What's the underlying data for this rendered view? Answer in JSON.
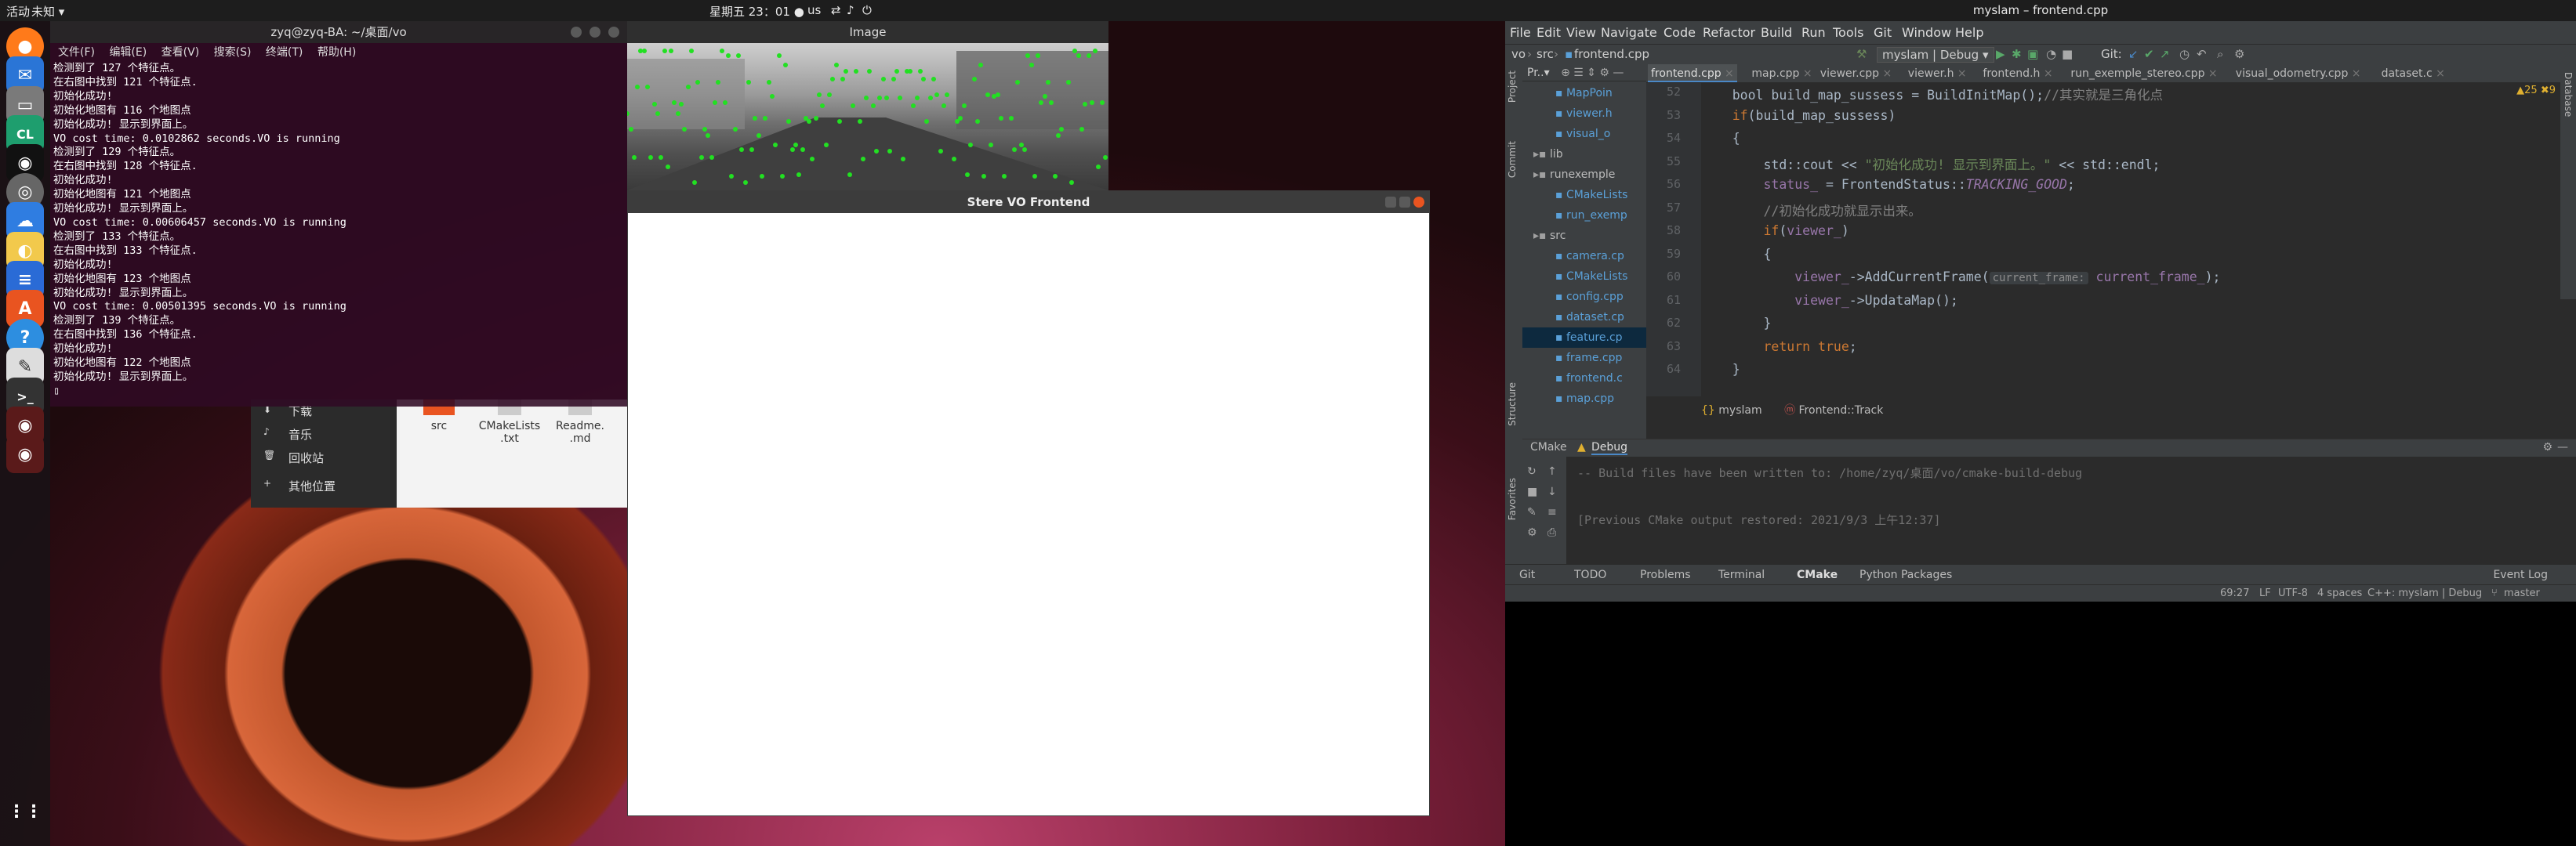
{
  "topbar": {
    "activities": "活动",
    "app_menu": "未知 ▾",
    "clock": "星期五 23：01 ●",
    "input_method": "us",
    "tray_icons": [
      "network-icon",
      "volume-icon",
      "power-icon"
    ]
  },
  "dock": {
    "apps": [
      "firefox-icon",
      "thunderbird-icon",
      "files-icon",
      "clion-icon",
      "qq-icon",
      "chrome-icon",
      "baidunetdisk-icon",
      "rhythmbox-icon",
      "writer-icon",
      "software-center-icon",
      "help-icon",
      "text-editor-icon",
      "terminal-icon",
      "stereo-vo-icon",
      "image-viewer-icon",
      "show-apps-icon"
    ],
    "clion_label": "CL"
  },
  "terminal": {
    "title": "zyq@zyq-BA: ~/桌面/vo",
    "menu": [
      "文件(F)",
      "编辑(E)",
      "查看(V)",
      "搜索(S)",
      "终端(T)",
      "帮助(H)"
    ],
    "lines": [
      "检测到了 127 个特征点。",
      "在右图中找到 121 个特征点.",
      "初始化成功!",
      "初始化地图有 116 个地图点",
      "初始化成功! 显示到界面上。",
      "VO cost time: 0.0102862 seconds.VO is running",
      "检测到了 129 个特征点。",
      "在右图中找到 128 个特征点.",
      "初始化成功!",
      "初始化地图有 121 个地图点",
      "初始化成功! 显示到界面上。",
      "VO cost time: 0.00606457 seconds.VO is running",
      "检测到了 133 个特征点。",
      "在右图中找到 133 个特征点.",
      "初始化成功!",
      "初始化地图有 123 个地图点",
      "初始化成功! 显示到界面上。",
      "VO cost time: 0.00501395 seconds.VO is running",
      "检测到了 139 个特征点。",
      "在右图中找到 136 个特征点.",
      "初始化成功!",
      "初始化地图有 122 个地图点",
      "初始化成功! 显示到界面上。"
    ]
  },
  "files": {
    "sidebar": [
      "下载",
      "音乐",
      "回收站",
      "其他位置"
    ],
    "items": [
      "src",
      "CMakeLists.txt",
      "Readme.md"
    ],
    "item_lines": [
      [
        "src"
      ],
      [
        "CMakeLists",
        ".txt"
      ],
      [
        "Readme.",
        ".md"
      ]
    ]
  },
  "image_window": {
    "title": "Image"
  },
  "stereo_window": {
    "title": "Stere VO Frontend"
  },
  "ide": {
    "title": "myslam – frontend.cpp",
    "menu": [
      "File",
      "Edit",
      "View",
      "Navigate",
      "Code",
      "Refactor",
      "Build",
      "Run",
      "Tools",
      "Git",
      "Window",
      "Help"
    ],
    "nav": [
      "vo",
      "src",
      "frontend.cpp"
    ],
    "run_config": "myslam | Debug ▾",
    "git_label": "Git:",
    "project_label": "Pr..▾",
    "tabs": [
      "frontend.cpp",
      "map.cpp",
      "viewer.cpp",
      "viewer.h",
      "frontend.h",
      "run_exemple_stereo.cpp",
      "visual_odometry.cpp",
      "dataset.c"
    ],
    "tree": [
      {
        "label": "MapPoin",
        "indent": 3
      },
      {
        "label": "viewer.h",
        "indent": 3
      },
      {
        "label": "visual_o",
        "indent": 3
      },
      {
        "label": "lib",
        "indent": 1
      },
      {
        "label": "runexemple",
        "indent": 1
      },
      {
        "label": "CMakeLists",
        "indent": 3
      },
      {
        "label": "run_exemp",
        "indent": 3
      },
      {
        "label": "src",
        "indent": 1
      },
      {
        "label": "camera.cp",
        "indent": 3
      },
      {
        "label": "CMakeLists",
        "indent": 3
      },
      {
        "label": "config.cpp",
        "indent": 3
      },
      {
        "label": "dataset.cp",
        "indent": 3
      },
      {
        "label": "feature.cp",
        "indent": 3
      },
      {
        "label": "frame.cpp",
        "indent": 3
      },
      {
        "label": "frontend.c",
        "indent": 3
      },
      {
        "label": "map.cpp",
        "indent": 3
      }
    ],
    "line_numbers": [
      "52",
      "53",
      "54",
      "55",
      "56",
      "57",
      "58",
      "59",
      "60",
      "61",
      "62",
      "63",
      "64"
    ],
    "code_lines": [
      [
        {
          "t": "    bool build_map_sussess = BuildInitMap();",
          "c": ""
        },
        {
          "t": "//其实就是三角化点",
          "c": "cm"
        }
      ],
      [
        {
          "t": "    ",
          "c": ""
        },
        {
          "t": "if",
          "c": "kw"
        },
        {
          "t": "(build_map_sussess)",
          "c": ""
        }
      ],
      [
        {
          "t": "    {",
          "c": ""
        }
      ],
      [
        {
          "t": "        std::cout << ",
          "c": ""
        },
        {
          "t": "\"初始化成功! 显示到界面上。\"",
          "c": "str"
        },
        {
          "t": " << std::endl;",
          "c": ""
        }
      ],
      [
        {
          "t": "        ",
          "c": ""
        },
        {
          "t": "status_",
          "c": "fld"
        },
        {
          "t": " = FrontendStatus::",
          "c": ""
        },
        {
          "t": "TRACKING_GOOD",
          "c": "st"
        },
        {
          "t": ";",
          "c": ""
        }
      ],
      [
        {
          "t": "        ",
          "c": ""
        },
        {
          "t": "//初始化成功就显示出来。",
          "c": "cm"
        }
      ],
      [
        {
          "t": "        ",
          "c": ""
        },
        {
          "t": "if",
          "c": "kw"
        },
        {
          "t": "(",
          "c": ""
        },
        {
          "t": "viewer_",
          "c": "fld"
        },
        {
          "t": ")",
          "c": ""
        }
      ],
      [
        {
          "t": "        {",
          "c": ""
        }
      ],
      [
        {
          "t": "            ",
          "c": ""
        },
        {
          "t": "viewer_",
          "c": "fld"
        },
        {
          "t": "->AddCurrentFrame(",
          "c": ""
        },
        {
          "t": "current_frame:",
          "c": "hint"
        },
        {
          "t": " ",
          "c": ""
        },
        {
          "t": "current_frame_",
          "c": "fld"
        },
        {
          "t": ");",
          "c": ""
        }
      ],
      [
        {
          "t": "            ",
          "c": ""
        },
        {
          "t": "viewer_",
          "c": "fld"
        },
        {
          "t": "->UpdataMap();",
          "c": ""
        }
      ],
      [
        {
          "t": "        }",
          "c": ""
        }
      ],
      [
        {
          "t": "        ",
          "c": ""
        },
        {
          "t": "return true",
          "c": "kw"
        },
        {
          "t": ";",
          "c": ""
        }
      ],
      [
        {
          "t": "    }",
          "c": ""
        }
      ]
    ],
    "warnings": "▲25  ✖9",
    "breadcrumb": [
      "myslam",
      "Frontend::Track"
    ],
    "cmake_tabs": [
      "CMake",
      "Debug"
    ],
    "cmake_output": [
      "-- Build files have been written to: /home/zyq/桌面/vo/cmake-build-debug",
      "",
      "[Previous CMake output restored: 2021/9/3 上午12:37]"
    ],
    "bottom_tabs": [
      "Git",
      "TODO",
      "Problems",
      "Terminal",
      "CMake",
      "Python Packages"
    ],
    "event_log": "Event Log",
    "status": {
      "position": "69:27",
      "line_sep": "LF",
      "encoding": "UTF-8",
      "indent": "4 spaces",
      "context": "C++: myslam | Debug",
      "branch": "master"
    },
    "side_tabs": [
      "Project",
      "Commit",
      "Structure",
      "Favorites"
    ],
    "right_tab": "Database"
  }
}
